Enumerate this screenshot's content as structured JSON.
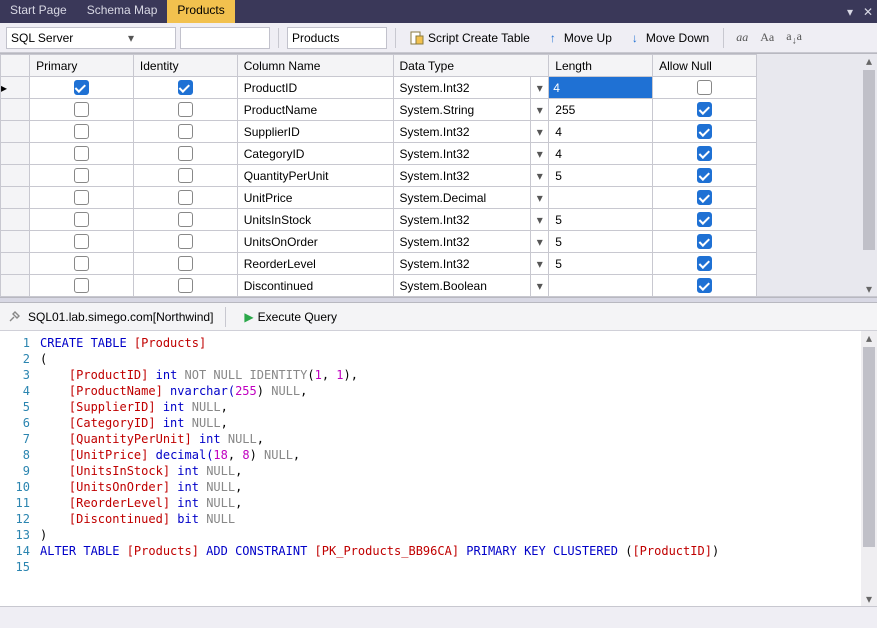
{
  "tabs": [
    "Start Page",
    "Schema Map",
    "Products"
  ],
  "activeTab": 2,
  "toolbar": {
    "dbCombo": "SQL Server",
    "tableLabel": "Products",
    "scriptCreate": "Script Create Table",
    "moveUp": "Move Up",
    "moveDown": "Move Down"
  },
  "grid": {
    "headers": [
      "",
      "Primary",
      "Identity",
      "Column Name",
      "Data Type",
      "Length",
      "Allow Null"
    ],
    "rows": [
      {
        "selected": true,
        "primary": true,
        "identity": true,
        "name": "ProductID",
        "type": "System.Int32",
        "len": "4",
        "lenEditing": true,
        "allowNull": false
      },
      {
        "selected": false,
        "primary": false,
        "identity": false,
        "name": "ProductName",
        "type": "System.String",
        "len": "255",
        "lenEditing": false,
        "allowNull": true
      },
      {
        "selected": false,
        "primary": false,
        "identity": false,
        "name": "SupplierID",
        "type": "System.Int32",
        "len": "4",
        "lenEditing": false,
        "allowNull": true
      },
      {
        "selected": false,
        "primary": false,
        "identity": false,
        "name": "CategoryID",
        "type": "System.Int32",
        "len": "4",
        "lenEditing": false,
        "allowNull": true
      },
      {
        "selected": false,
        "primary": false,
        "identity": false,
        "name": "QuantityPerUnit",
        "type": "System.Int32",
        "len": "5",
        "lenEditing": false,
        "allowNull": true
      },
      {
        "selected": false,
        "primary": false,
        "identity": false,
        "name": "UnitPrice",
        "type": "System.Decimal",
        "len": "",
        "lenEditing": false,
        "allowNull": true
      },
      {
        "selected": false,
        "primary": false,
        "identity": false,
        "name": "UnitsInStock",
        "type": "System.Int32",
        "len": "5",
        "lenEditing": false,
        "allowNull": true
      },
      {
        "selected": false,
        "primary": false,
        "identity": false,
        "name": "UnitsOnOrder",
        "type": "System.Int32",
        "len": "5",
        "lenEditing": false,
        "allowNull": true
      },
      {
        "selected": false,
        "primary": false,
        "identity": false,
        "name": "ReorderLevel",
        "type": "System.Int32",
        "len": "5",
        "lenEditing": false,
        "allowNull": true
      },
      {
        "selected": false,
        "primary": false,
        "identity": false,
        "name": "Discontinued",
        "type": "System.Boolean",
        "len": "",
        "lenEditing": false,
        "allowNull": true
      }
    ]
  },
  "queryBar": {
    "connection": "SQL01.lab.simego.com[Northwind]",
    "execute": "Execute Query"
  },
  "sql": {
    "lines": 15,
    "l1": {
      "a": "CREATE TABLE ",
      "b": "[Products]"
    },
    "l2": "(",
    "l3": {
      "a": "    ",
      "b": "[ProductID]",
      "c": " int ",
      "d": "NOT NULL IDENTITY",
      "e": "(",
      "f": "1",
      "g": ", ",
      "h": "1",
      "i": "),"
    },
    "l4": {
      "a": "    ",
      "b": "[ProductName]",
      "c": " nvarchar(",
      "d": "255",
      "e": ") ",
      "f": "NULL",
      "g": ","
    },
    "l5": {
      "a": "    ",
      "b": "[SupplierID]",
      "c": " int ",
      "d": "NULL",
      "e": ","
    },
    "l6": {
      "a": "    ",
      "b": "[CategoryID]",
      "c": " int ",
      "d": "NULL",
      "e": ","
    },
    "l7": {
      "a": "    ",
      "b": "[QuantityPerUnit]",
      "c": " int ",
      "d": "NULL",
      "e": ","
    },
    "l8": {
      "a": "    ",
      "b": "[UnitPrice]",
      "c": " decimal(",
      "d": "18",
      "e": ", ",
      "f": "8",
      "g": ") ",
      "h": "NULL",
      "i": ","
    },
    "l9": {
      "a": "    ",
      "b": "[UnitsInStock]",
      "c": " int ",
      "d": "NULL",
      "e": ","
    },
    "l10": {
      "a": "    ",
      "b": "[UnitsOnOrder]",
      "c": " int ",
      "d": "NULL",
      "e": ","
    },
    "l11": {
      "a": "    ",
      "b": "[ReorderLevel]",
      "c": " int ",
      "d": "NULL",
      "e": ","
    },
    "l12": {
      "a": "    ",
      "b": "[Discontinued]",
      "c": " bit ",
      "d": "NULL"
    },
    "l13": ")",
    "l14": {
      "a": "ALTER TABLE ",
      "b": "[Products]",
      "c": " ADD CONSTRAINT ",
      "d": "[PK_Products_BB96CA]",
      "e": " PRIMARY KEY CLUSTERED ",
      "f": "(",
      "g": "[ProductID]",
      "h": ")"
    }
  }
}
